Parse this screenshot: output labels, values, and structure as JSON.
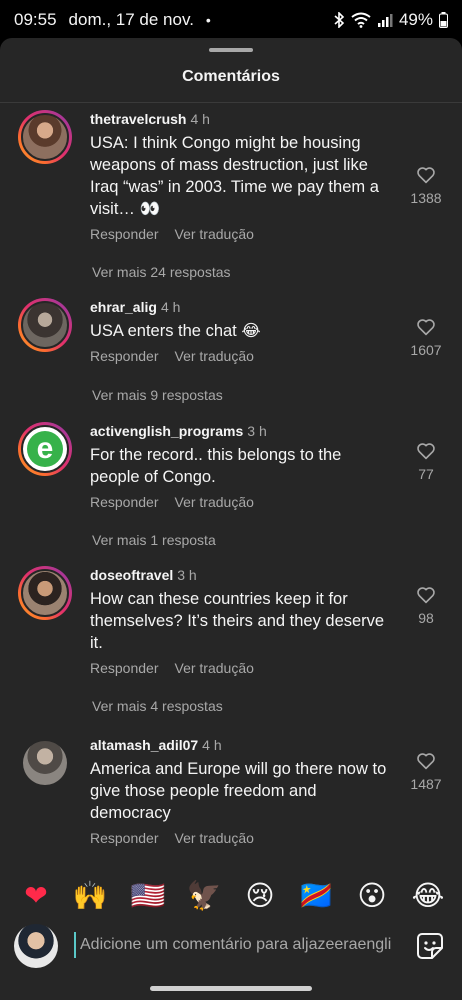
{
  "status_bar": {
    "time": "09:55",
    "date": "dom., 17 de nov.",
    "dot": "•",
    "battery": "49%"
  },
  "sheet": {
    "title": "Comentários"
  },
  "comments": [
    {
      "username": "thetravelcrush",
      "time": "4 h",
      "text": "USA: I think Congo might be housing weapons of mass destruction, just like Iraq “was” in 2003. Time we pay them a visit… 👀",
      "reply_label": "Responder",
      "translate_label": "Ver tradução",
      "likes": "1388",
      "more_replies": "Ver mais 24 respostas"
    },
    {
      "username": "ehrar_alig",
      "time": "4 h",
      "text": "USA enters the chat 😂",
      "reply_label": "Responder",
      "translate_label": "Ver tradução",
      "likes": "1607",
      "more_replies": "Ver mais 9 respostas"
    },
    {
      "username": "activenglish_programs",
      "time": "3 h",
      "text": "For the record.. this belongs to the people of Congo.",
      "reply_label": "Responder",
      "translate_label": "Ver tradução",
      "likes": "77",
      "more_replies": "Ver mais 1 resposta"
    },
    {
      "username": "doseoftravel",
      "time": "3 h",
      "text": "How can these countries keep it for themselves? It’s theirs and they deserve it.",
      "reply_label": "Responder",
      "translate_label": "Ver tradução",
      "likes": "98",
      "more_replies": "Ver mais 4 respostas"
    },
    {
      "username": "altamash_adil07",
      "time": "4 h",
      "text": "America and Europe will go there now to give those people freedom and democracy",
      "reply_label": "Responder",
      "translate_label": "Ver tradução",
      "likes": "1487"
    }
  ],
  "emoji_bar": {
    "emojis": [
      "❤",
      "🙌",
      "🇺🇸",
      "🦅",
      "😢",
      "🇨🇩",
      "😮",
      "😂"
    ]
  },
  "input": {
    "placeholder": "Adicione um comentário para aljazeeraengli"
  },
  "colors": {
    "sheet_bg": "#262626",
    "secondary_text": "#a8a8a8",
    "story_ring": "#e1306c"
  }
}
